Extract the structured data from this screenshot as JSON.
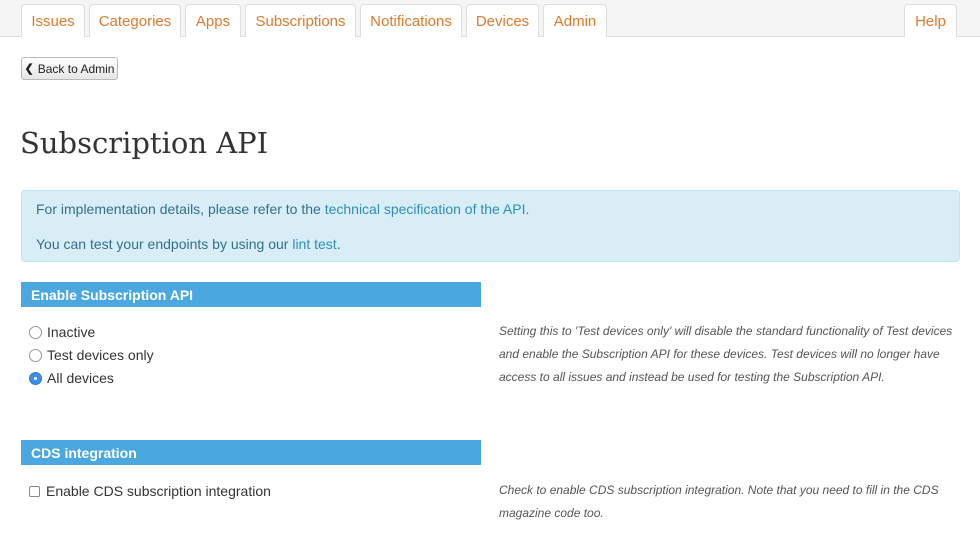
{
  "nav": {
    "tabs": [
      {
        "label": "Issues"
      },
      {
        "label": "Categories"
      },
      {
        "label": "Apps"
      },
      {
        "label": "Subscriptions"
      },
      {
        "label": "Notifications"
      },
      {
        "label": "Devices"
      },
      {
        "label": "Admin"
      }
    ],
    "help": "Help",
    "accent_color": "#e07b2a"
  },
  "back_button": {
    "label": "Back to Admin",
    "icon": "chevron-left-icon"
  },
  "page_title": "Subscription API",
  "info": {
    "line1_prefix": "For implementation details, please refer to the ",
    "line1_link": "technical specification of the API",
    "line1_suffix": ".",
    "line2_prefix": "You can test your endpoints by using our ",
    "line2_link": "lint test",
    "line2_suffix": "."
  },
  "enable_section": {
    "title": "Enable Subscription API",
    "options": [
      {
        "label": "Inactive",
        "checked": false
      },
      {
        "label": "Test devices only",
        "checked": false
      },
      {
        "label": "All devices",
        "checked": true
      }
    ],
    "help": "Setting this to 'Test devices only' will disable the standard functionality of Test devices and enable the Subscription API for these devices. Test devices will no longer have access to all issues and instead be used for testing the Subscription API."
  },
  "cds_section": {
    "title": "CDS integration",
    "checkbox_label": "Enable CDS subscription integration",
    "checked": false,
    "help": "Check to enable CDS subscription integration. Note that you need to fill in the CDS magazine code too."
  },
  "header_color": "#4aa7e0"
}
